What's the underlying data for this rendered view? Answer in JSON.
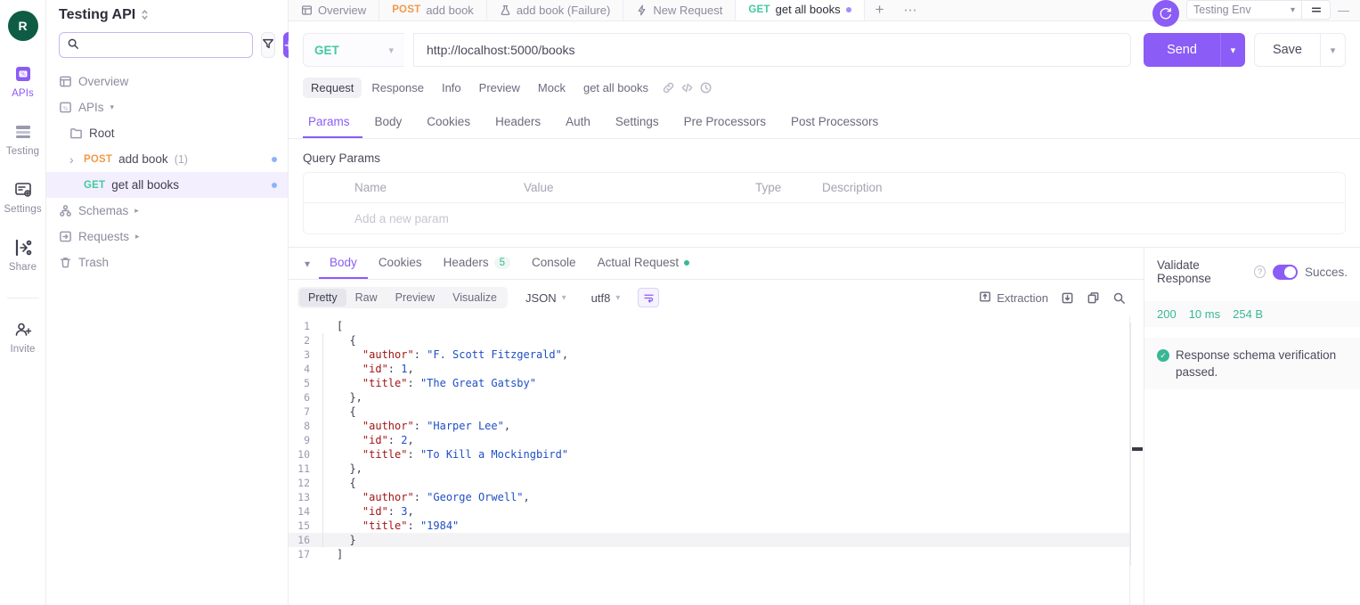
{
  "rail": {
    "avatar_initial": "R",
    "items": [
      {
        "label": "APIs",
        "icon": "apis-icon",
        "active": true
      },
      {
        "label": "Testing",
        "icon": "testing-icon",
        "active": false
      },
      {
        "label": "Settings",
        "icon": "settings-icon",
        "active": false
      },
      {
        "label": "Share",
        "icon": "share-icon",
        "active": false
      },
      {
        "label": "Invite",
        "icon": "invite-icon",
        "active": false
      }
    ]
  },
  "sidebar": {
    "workspace_title": "Testing API",
    "search_placeholder": "",
    "search_value": "",
    "filter_label": "filter",
    "add_label": "+",
    "tree": [
      {
        "label": "Overview",
        "icon": "overview-icon",
        "level": 0
      },
      {
        "label": "APIs",
        "icon": "apis-icon",
        "level": 0,
        "caret": "down"
      },
      {
        "label": "Root",
        "icon": "folder-icon",
        "level": 1
      },
      {
        "verb": "POST",
        "label": "add book",
        "count": "(1)",
        "level": 2,
        "caret": "right",
        "dot": true
      },
      {
        "verb": "GET",
        "label": "get all books",
        "level": 2,
        "selected": true,
        "dot": true
      },
      {
        "label": "Schemas",
        "icon": "schemas-icon",
        "level": 0,
        "caret": "right"
      },
      {
        "label": "Requests",
        "icon": "requests-icon",
        "level": 0,
        "caret": "right"
      },
      {
        "label": "Trash",
        "icon": "trash-icon",
        "level": 0
      }
    ]
  },
  "tabbar": {
    "tabs": [
      {
        "label": "Overview",
        "icon": "overview-icon",
        "active": false
      },
      {
        "verb": "POST",
        "label": "add book",
        "active": false
      },
      {
        "label": "add book (Failure)",
        "icon": "flask-icon",
        "active": false
      },
      {
        "label": "New Request",
        "icon": "bolt-icon",
        "active": false
      },
      {
        "verb": "GET",
        "label": "get all books",
        "active": true,
        "dot": true
      }
    ],
    "new_tab_label": "+",
    "more_label": "⋯",
    "environment": "Testing Env",
    "minimize_label": "—"
  },
  "request": {
    "method": "GET",
    "url": "http://localhost:5000/books",
    "send_label": "Send",
    "save_label": "Save",
    "pills": [
      {
        "label": "Request",
        "active": true
      },
      {
        "label": "Response",
        "active": false
      },
      {
        "label": "Info",
        "active": false
      },
      {
        "label": "Preview",
        "active": false
      },
      {
        "label": "Mock",
        "active": false
      },
      {
        "label": "get all books",
        "active": false,
        "plain": true
      }
    ],
    "pill_icons": [
      "link-icon",
      "code-icon",
      "history-icon"
    ],
    "tabs": [
      {
        "label": "Params",
        "active": true
      },
      {
        "label": "Body",
        "active": false
      },
      {
        "label": "Cookies",
        "active": false
      },
      {
        "label": "Headers",
        "active": false
      },
      {
        "label": "Auth",
        "active": false
      },
      {
        "label": "Settings",
        "active": false
      },
      {
        "label": "Pre Processors",
        "active": false
      },
      {
        "label": "Post Processors",
        "active": false
      }
    ],
    "query_params": {
      "title": "Query Params",
      "columns": [
        "Name",
        "Value",
        "Type",
        "Description"
      ],
      "empty_placeholder": "Add a new param"
    }
  },
  "response": {
    "tabs": [
      {
        "label": "Body",
        "active": true
      },
      {
        "label": "Cookies",
        "active": false
      },
      {
        "label": "Headers",
        "active": false,
        "count": "5"
      },
      {
        "label": "Console",
        "active": false
      },
      {
        "label": "Actual Request",
        "active": false,
        "dot": true
      }
    ],
    "format_pills": [
      {
        "label": "Pretty",
        "active": true
      },
      {
        "label": "Raw",
        "active": false
      },
      {
        "label": "Preview",
        "active": false
      },
      {
        "label": "Visualize",
        "active": false
      }
    ],
    "content_type": "JSON",
    "encoding": "utf8",
    "wrap_icon": "word-wrap-icon",
    "actions": [
      {
        "label": "Extraction",
        "icon": "extraction-icon"
      },
      {
        "label": "",
        "icon": "download-icon"
      },
      {
        "label": "",
        "icon": "copy-icon"
      },
      {
        "label": "",
        "icon": "search-icon"
      }
    ],
    "body_lines": [
      {
        "n": "1",
        "indent": 0,
        "tokens": [
          {
            "t": "p",
            "v": "["
          }
        ]
      },
      {
        "n": "2",
        "indent": 1,
        "tokens": [
          {
            "t": "p",
            "v": "  {"
          }
        ]
      },
      {
        "n": "3",
        "indent": 1,
        "tokens": [
          {
            "t": "k",
            "v": "    \"author\""
          },
          {
            "t": "p",
            "v": ": "
          },
          {
            "t": "s",
            "v": "\"F. Scott Fitzgerald\""
          },
          {
            "t": "p",
            "v": ","
          }
        ]
      },
      {
        "n": "4",
        "indent": 1,
        "tokens": [
          {
            "t": "k",
            "v": "    \"id\""
          },
          {
            "t": "p",
            "v": ": "
          },
          {
            "t": "n",
            "v": "1"
          },
          {
            "t": "p",
            "v": ","
          }
        ]
      },
      {
        "n": "5",
        "indent": 1,
        "tokens": [
          {
            "t": "k",
            "v": "    \"title\""
          },
          {
            "t": "p",
            "v": ": "
          },
          {
            "t": "s",
            "v": "\"The Great Gatsby\""
          }
        ]
      },
      {
        "n": "6",
        "indent": 1,
        "tokens": [
          {
            "t": "p",
            "v": "  },"
          }
        ]
      },
      {
        "n": "7",
        "indent": 1,
        "tokens": [
          {
            "t": "p",
            "v": "  {"
          }
        ]
      },
      {
        "n": "8",
        "indent": 1,
        "tokens": [
          {
            "t": "k",
            "v": "    \"author\""
          },
          {
            "t": "p",
            "v": ": "
          },
          {
            "t": "s",
            "v": "\"Harper Lee\""
          },
          {
            "t": "p",
            "v": ","
          }
        ]
      },
      {
        "n": "9",
        "indent": 1,
        "tokens": [
          {
            "t": "k",
            "v": "    \"id\""
          },
          {
            "t": "p",
            "v": ": "
          },
          {
            "t": "n",
            "v": "2"
          },
          {
            "t": "p",
            "v": ","
          }
        ]
      },
      {
        "n": "10",
        "indent": 1,
        "tokens": [
          {
            "t": "k",
            "v": "    \"title\""
          },
          {
            "t": "p",
            "v": ": "
          },
          {
            "t": "s",
            "v": "\"To Kill a Mockingbird\""
          }
        ]
      },
      {
        "n": "11",
        "indent": 1,
        "tokens": [
          {
            "t": "p",
            "v": "  },"
          }
        ]
      },
      {
        "n": "12",
        "indent": 1,
        "tokens": [
          {
            "t": "p",
            "v": "  {"
          }
        ]
      },
      {
        "n": "13",
        "indent": 1,
        "tokens": [
          {
            "t": "k",
            "v": "    \"author\""
          },
          {
            "t": "p",
            "v": ": "
          },
          {
            "t": "s",
            "v": "\"George Orwell\""
          },
          {
            "t": "p",
            "v": ","
          }
        ]
      },
      {
        "n": "14",
        "indent": 1,
        "tokens": [
          {
            "t": "k",
            "v": "    \"id\""
          },
          {
            "t": "p",
            "v": ": "
          },
          {
            "t": "n",
            "v": "3"
          },
          {
            "t": "p",
            "v": ","
          }
        ]
      },
      {
        "n": "15",
        "indent": 1,
        "tokens": [
          {
            "t": "k",
            "v": "    \"title\""
          },
          {
            "t": "p",
            "v": ": "
          },
          {
            "t": "s",
            "v": "\"1984\""
          }
        ]
      },
      {
        "n": "16",
        "indent": 1,
        "highlight": true,
        "tokens": [
          {
            "t": "p",
            "v": "  }"
          }
        ]
      },
      {
        "n": "17",
        "indent": 0,
        "tokens": [
          {
            "t": "p",
            "v": "]"
          }
        ]
      }
    ]
  },
  "validation": {
    "title": "Validate Response",
    "status_label": "Succes.",
    "toggle_on": true,
    "status_code": "200",
    "time": "10 ms",
    "size": "254 B",
    "message": "Response schema verification passed."
  }
}
